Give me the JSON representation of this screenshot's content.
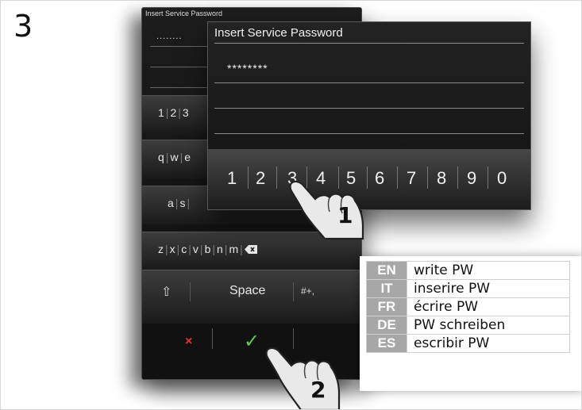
{
  "step_number": "3",
  "back_screen": {
    "title": "Insert Service Password",
    "password_mask": "........",
    "rows": {
      "digits": [
        "1",
        "2",
        "3"
      ],
      "qwe": [
        "q",
        "w",
        "e"
      ],
      "as": [
        "a",
        "s"
      ],
      "zxcv": [
        "z",
        "x",
        "c",
        "v",
        "b",
        "n",
        "m"
      ]
    },
    "backspace_icon": "backspace-icon",
    "shift_icon": "shift-arrow-icon",
    "shift_glyph": "⇧",
    "space_label": "Space",
    "symbols_label": "#+,",
    "cancel_glyph": "×",
    "confirm_glyph": "✓",
    "cancel_color": "#e0333a",
    "confirm_color": "#62c94a"
  },
  "front_screen": {
    "title": "Insert Service Password",
    "password_mask": "********",
    "digits": [
      "1",
      "2",
      "3",
      "4",
      "5",
      "6",
      "7",
      "8",
      "9",
      "0"
    ]
  },
  "callouts": {
    "finger_1": "1",
    "finger_2": "2"
  },
  "translations": [
    {
      "lang": "EN",
      "text": "write PW"
    },
    {
      "lang": "IT",
      "text": "inserire PW"
    },
    {
      "lang": "FR",
      "text": "écrire PW"
    },
    {
      "lang": "DE",
      "text": "PW schreiben"
    },
    {
      "lang": "ES",
      "text": "escribir PW"
    }
  ],
  "colors": {
    "lang_cell": "#a7a7a7",
    "screen_bg": "#1a1a1a"
  }
}
